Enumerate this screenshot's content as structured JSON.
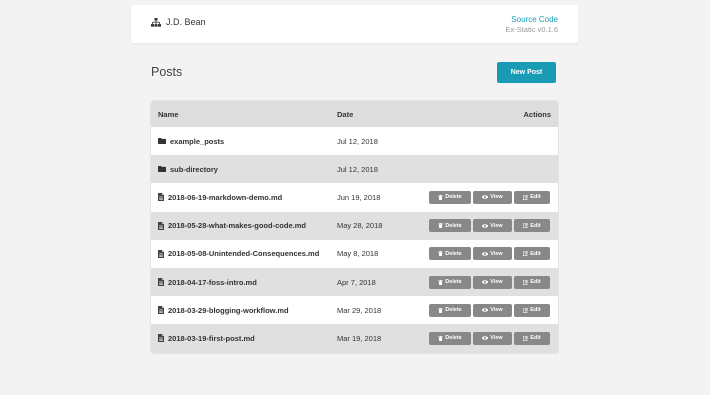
{
  "header": {
    "brand_name": "J.D. Bean",
    "source_link": "Source Code",
    "version": "Ex-Static v0.1.6",
    "brand_icon": "sitemap-icon"
  },
  "page": {
    "title": "Posts",
    "new_post_label": "New Post"
  },
  "table": {
    "headers": {
      "name": "Name",
      "date": "Date",
      "actions": "Actions"
    },
    "action_labels": {
      "delete": "Delete",
      "view": "View",
      "edit": "Edit"
    },
    "rows": [
      {
        "type": "folder",
        "name": "example_posts",
        "date": "Jul 12, 2018",
        "actions": false
      },
      {
        "type": "folder",
        "name": "sub-directory",
        "date": "Jul 12, 2018",
        "actions": false
      },
      {
        "type": "file",
        "name": "2018-06-19-markdown-demo.md",
        "date": "Jun 19, 2018",
        "actions": true
      },
      {
        "type": "file",
        "name": "2018-05-28-what-makes-good-code.md",
        "date": "May 28, 2018",
        "actions": true
      },
      {
        "type": "file",
        "name": "2018-05-08-Unintended-Consequences.md",
        "date": "May 8, 2018",
        "actions": true
      },
      {
        "type": "file",
        "name": "2018-04-17-foss-intro.md",
        "date": "Apr 7, 2018",
        "actions": true
      },
      {
        "type": "file",
        "name": "2018-03-29-blogging-workflow.md",
        "date": "Mar 29, 2018",
        "actions": true
      },
      {
        "type": "file",
        "name": "2018-03-19-first-post.md",
        "date": "Mar 19, 2018",
        "actions": true
      }
    ]
  },
  "colors": {
    "accent": "#1a9bb5",
    "action_button": "#888888",
    "row_alt": "#e0e0e0",
    "header_bg": "#dddddd"
  }
}
